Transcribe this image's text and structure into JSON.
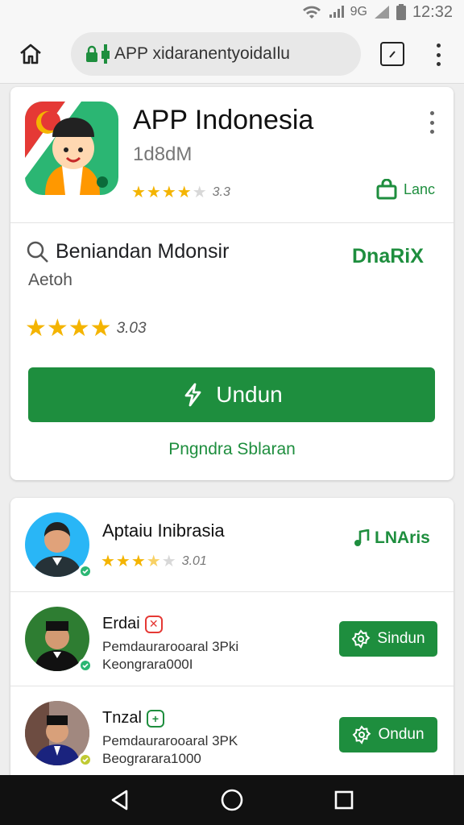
{
  "status": {
    "signal_text": "9G",
    "time": "12:32"
  },
  "browser": {
    "url": "APP xidaranentyoidaIlu",
    "tabs_count": ""
  },
  "app": {
    "title": "APP Indonesia",
    "size": "1d8dM",
    "rating_value": 3.5,
    "rating_text": "3.3",
    "store_link": "Lanc",
    "search_title": "Beniandan Mdonsir",
    "green_link": "DnaRiX",
    "sub_label": "Aetoh",
    "big_rating_value": 4,
    "big_rating_text": "3.03",
    "download_label": "Undun",
    "sub_link": "Pngndra Sblaran"
  },
  "list": [
    {
      "title": "Aptaiu Inibrasia",
      "rating_value": 3.5,
      "rating_text": "3.01",
      "link_label": "LNAris"
    },
    {
      "title": "Erdai",
      "line1": "Pemdaurarooaral 3Pki",
      "line2": "Keongrara000I",
      "button_label": "Sindun",
      "tag_color": "#e53935"
    },
    {
      "title": "Tnzal",
      "line1": "Pemdaurarooaral 3PK",
      "line2": "Beograrara1000",
      "button_label": "Ondun",
      "tag_color": "#1e8e3e"
    }
  ],
  "colors": {
    "accent": "#1e8e3e",
    "star": "#f4b400"
  },
  "icons": [
    "wifi-icon",
    "signal-icon",
    "battery-icon",
    "home-icon",
    "lock-icon",
    "tabs-icon",
    "more-icon",
    "search-icon",
    "download-icon",
    "back-icon",
    "home-circle-icon",
    "recents-icon"
  ]
}
